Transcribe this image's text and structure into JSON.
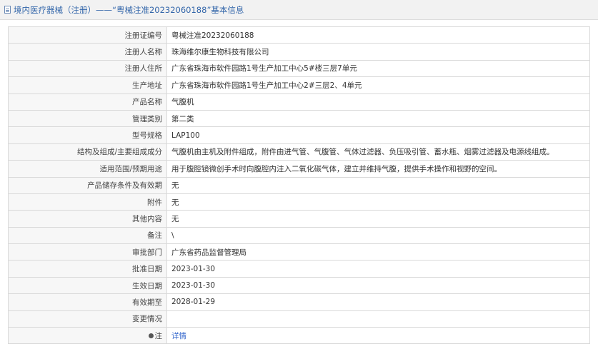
{
  "header": {
    "title": "境内医疗器械（注册）——“粤械注准20232060188”基本信息"
  },
  "rows": [
    {
      "label": "注册证编号",
      "value": "粤械注准20232060188"
    },
    {
      "label": "注册人名称",
      "value": "珠海维尔康生物科技有限公司"
    },
    {
      "label": "注册人住所",
      "value": "广东省珠海市软件园路1号生产加工中心5#楼三层7单元"
    },
    {
      "label": "生产地址",
      "value": "广东省珠海市软件园路1号生产加工中心2#三层2、4单元"
    },
    {
      "label": "产品名称",
      "value": "气腹机"
    },
    {
      "label": "管理类别",
      "value": "第二类"
    },
    {
      "label": "型号规格",
      "value": "LAP100"
    },
    {
      "label": "结构及组成/主要组成成分",
      "value": "气腹机由主机及附件组成，附件由进气管、气腹管、气体过滤器、负压吸引管、蓄水瓶、烟雾过滤器及电源线组成。"
    },
    {
      "label": "适用范围/预期用途",
      "value": "用于腹腔镜微创手术时向腹腔内注入二氧化碳气体，建立并维持气腹，提供手术操作和视野的空间。"
    },
    {
      "label": "产品储存条件及有效期",
      "value": "无"
    },
    {
      "label": "附件",
      "value": "无"
    },
    {
      "label": "其他内容",
      "value": "无"
    },
    {
      "label": "备注",
      "value": "\\"
    },
    {
      "label": "审批部门",
      "value": "广东省药品监督管理局"
    },
    {
      "label": "批准日期",
      "value": "2023-01-30"
    },
    {
      "label": "生效日期",
      "value": "2023-01-30"
    },
    {
      "label": "有效期至",
      "value": "2028-01-29"
    },
    {
      "label": "变更情况",
      "value": ""
    }
  ],
  "note_row": {
    "label": "注",
    "link": "详情"
  }
}
